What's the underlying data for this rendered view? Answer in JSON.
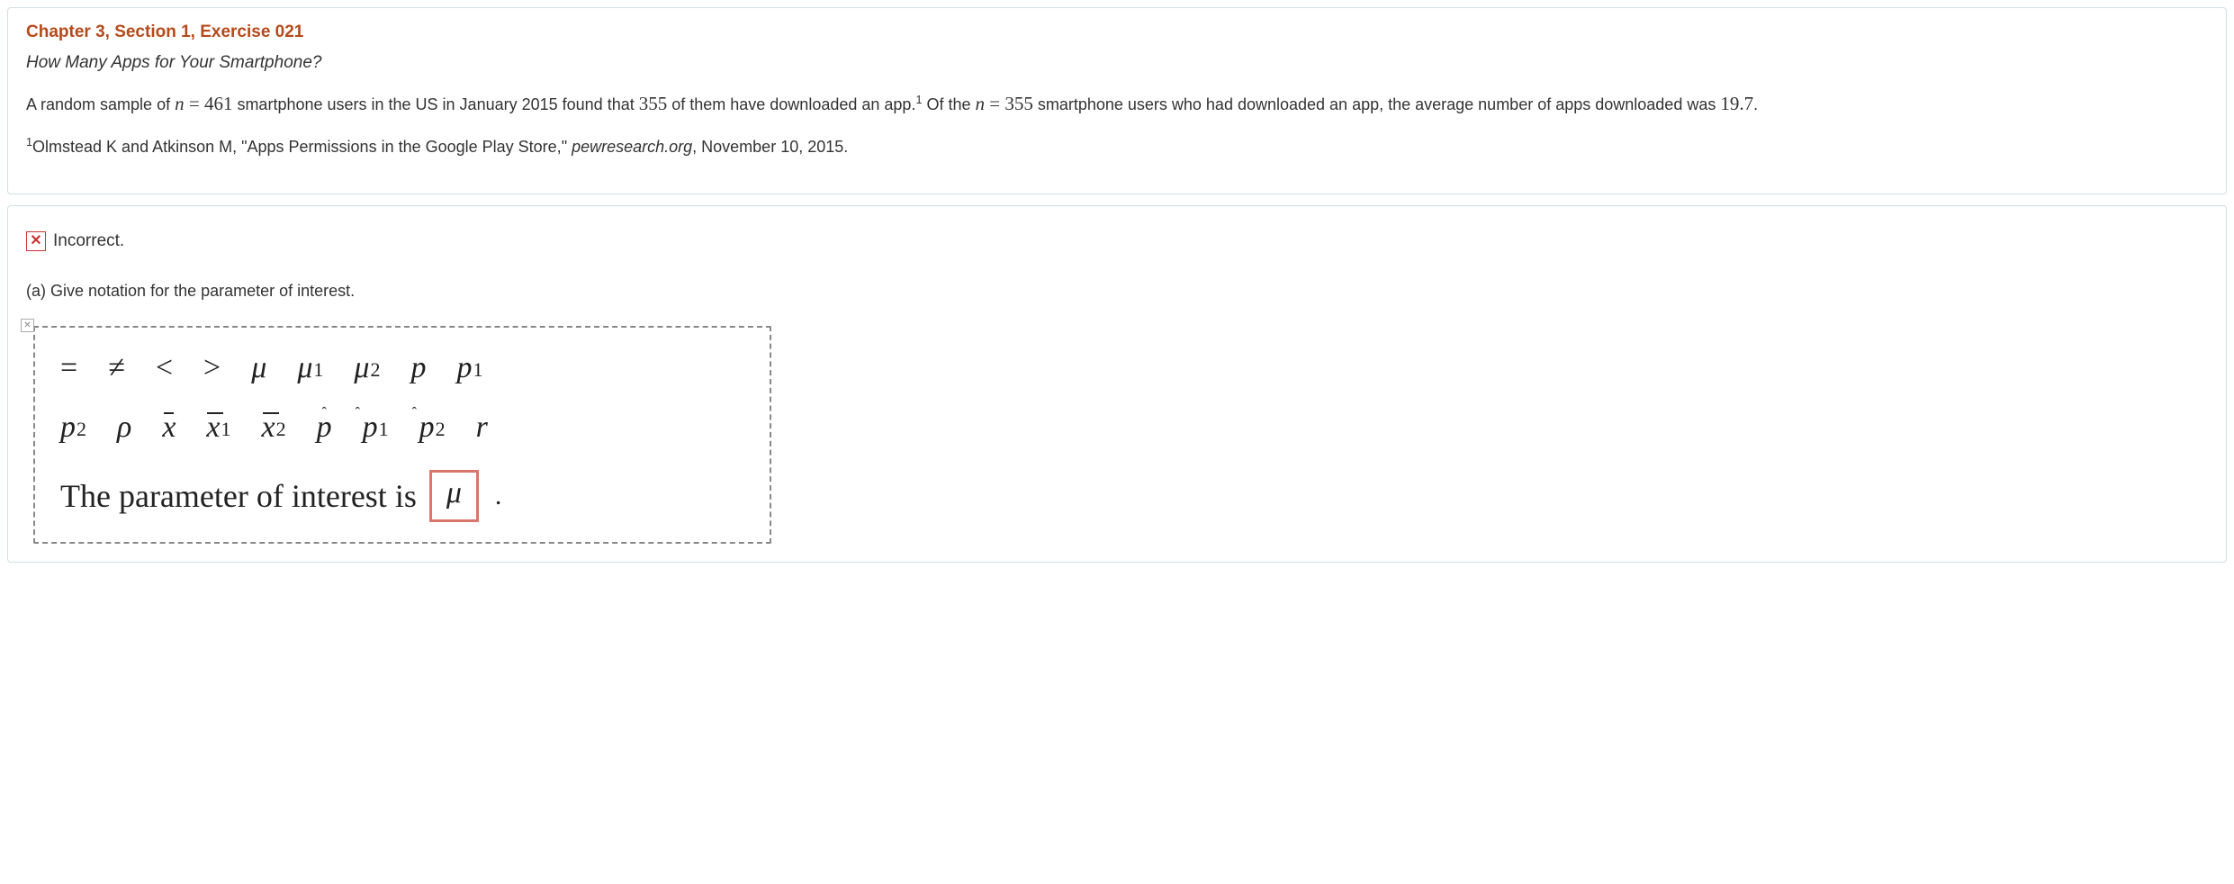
{
  "header": {
    "title": "Chapter 3, Section 1, Exercise 021",
    "subtitle": "How Many Apps for Your Smartphone?"
  },
  "problem": {
    "p1_a": "A random sample of ",
    "p1_var_n": "n",
    "p1_eq": " = ",
    "p1_n1": "461",
    "p1_b": " smartphone users in the US in January 2015 found that ",
    "p1_n2": "355",
    "p1_c": " of them have downloaded an app.",
    "p1_sup": "1",
    "p1_d": " Of the ",
    "p1_n3": "355",
    "p1_e": " smartphone users who had downloaded an app, the average number of apps downloaded was ",
    "p1_n4": "19.7",
    "p1_f": ".",
    "foot_sup": "1",
    "foot_a": "Olmstead K and Atkinson M, \"Apps Permissions in the Google Play Store,\" ",
    "foot_site": "pewresearch.org",
    "foot_b": ", November 10, 2015."
  },
  "feedback": {
    "icon_glyph": "✕",
    "text": "Incorrect."
  },
  "part_a": {
    "label": "(a) Give notation for the parameter of interest.",
    "small_x": "✕",
    "symbols_row1": {
      "eq": "=",
      "neq": "≠",
      "lt": "<",
      "gt": ">",
      "mu": "μ",
      "mu1_base": "μ",
      "mu1_sub": "1",
      "mu2_base": "μ",
      "mu2_sub": "2",
      "p": "p",
      "p1_base": "p",
      "p1_sub": "1"
    },
    "symbols_row2": {
      "p2_base": "p",
      "p2_sub": "2",
      "rho": "ρ",
      "xbar": "x",
      "xbar1_base": "x",
      "xbar1_sub": "1",
      "xbar2_base": "x",
      "xbar2_sub": "2",
      "phat": "p",
      "phat_hat": "ˆ",
      "phat1_base": "p",
      "phat1_sub": "1",
      "phat2_base": "p",
      "phat2_sub": "2",
      "r": "r"
    },
    "statement": "The parameter of interest is",
    "answer": "μ",
    "period": "."
  }
}
